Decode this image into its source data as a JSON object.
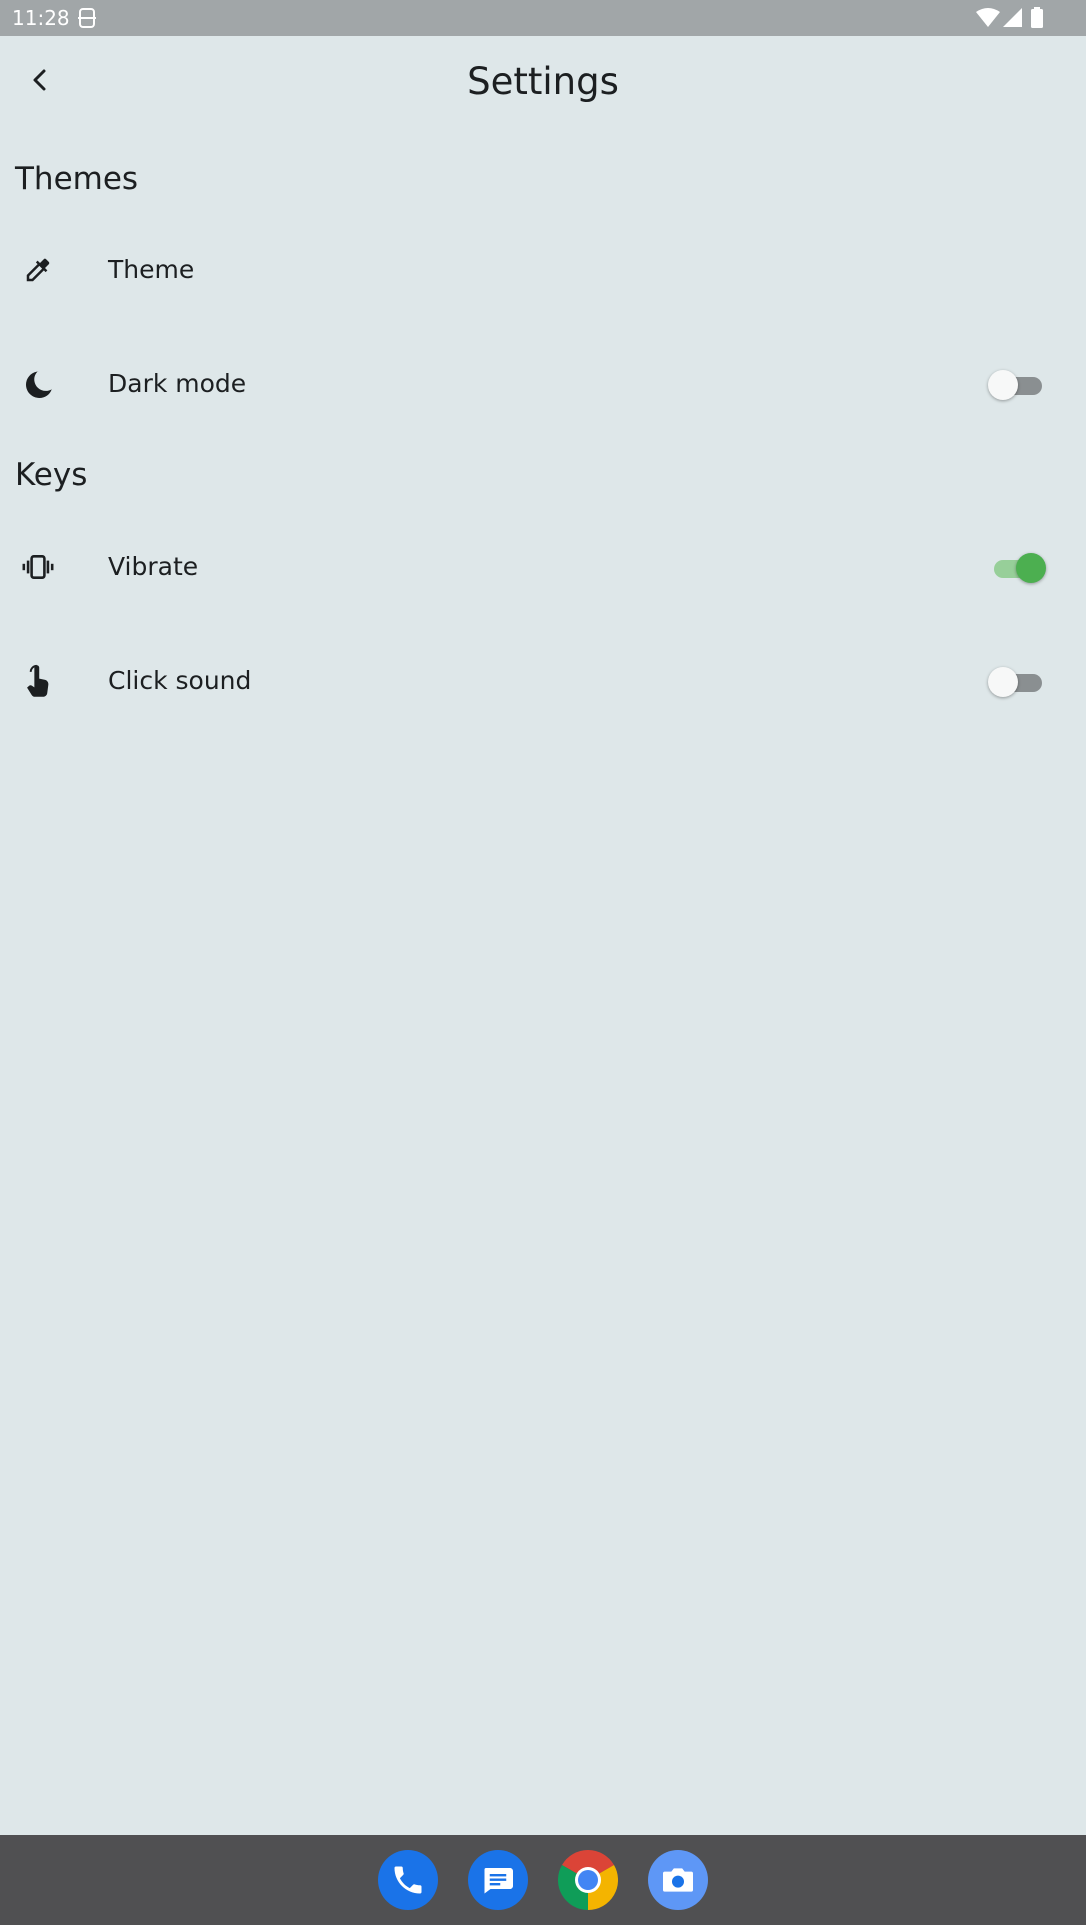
{
  "status_bar": {
    "time": "11:28"
  },
  "app_bar": {
    "title": "Settings",
    "back_icon": "chevron-left-icon"
  },
  "sections": [
    {
      "header": "Themes",
      "items": [
        {
          "label": "Theme",
          "icon": "eyedropper-icon"
        },
        {
          "label": "Dark mode",
          "icon": "moon-icon",
          "switch_on": false
        }
      ]
    },
    {
      "header": "Keys",
      "items": [
        {
          "label": "Vibrate",
          "icon": "vibrate-icon",
          "switch_on": true
        },
        {
          "label": "Click sound",
          "icon": "touch-icon",
          "switch_on": false
        }
      ]
    }
  ],
  "dock": {
    "apps": [
      "phone-icon",
      "messages-icon",
      "chrome-icon",
      "camera-icon"
    ]
  },
  "colors": {
    "background": "#dee7e9",
    "status_bar": "#a1a6a8",
    "dock": "#505052",
    "switch_on": "#4caf50",
    "switch_off_track": "#8a8f91"
  }
}
